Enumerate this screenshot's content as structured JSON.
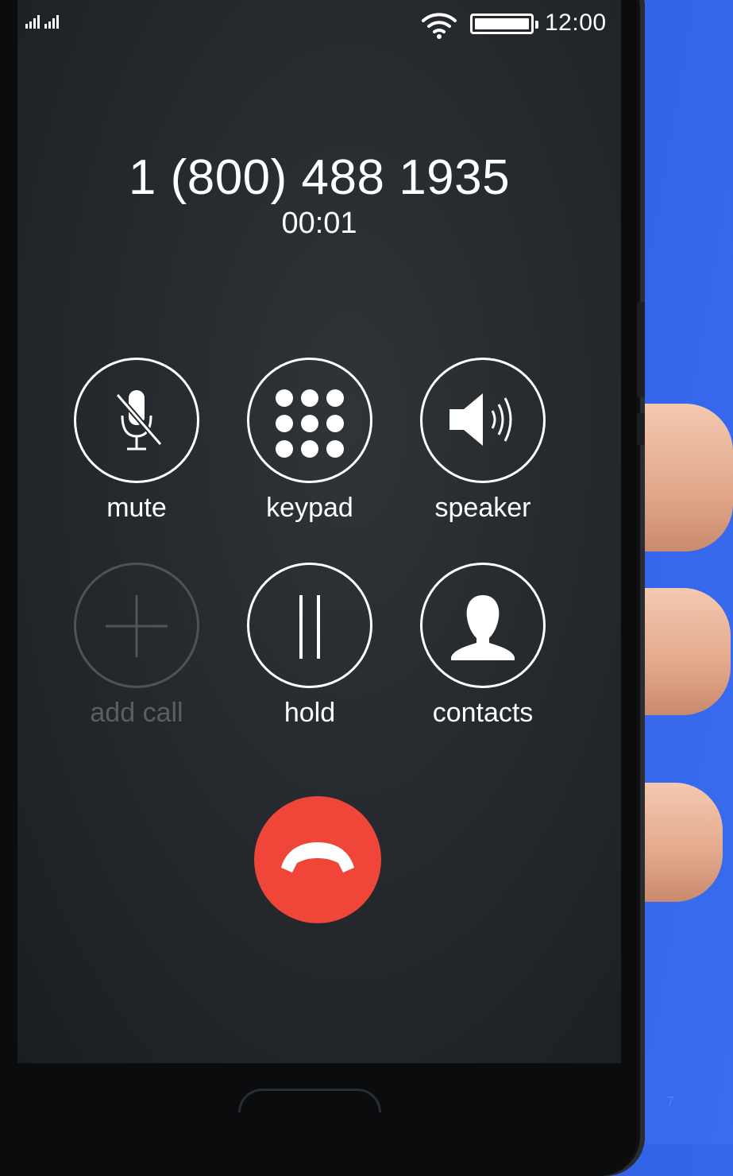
{
  "status_bar": {
    "time": "12:00"
  },
  "call": {
    "number": "1 (800) 488 1935",
    "duration": "00:01"
  },
  "controls": {
    "mute": "mute",
    "keypad": "keypad",
    "speaker": "speaker",
    "add_call": "add call",
    "hold": "hold",
    "contacts": "contacts"
  },
  "slide_number": "7",
  "colors": {
    "background": "#2f5fe6",
    "end_call": "#f0463a",
    "screen": "#262a2e"
  }
}
